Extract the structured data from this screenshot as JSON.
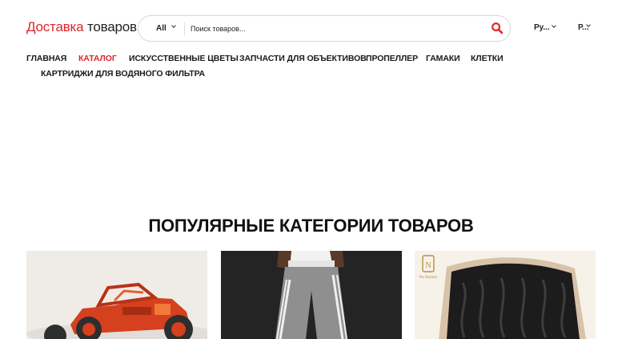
{
  "header": {
    "logo_accent": "Доставка",
    "logo_rest": "товаров",
    "search": {
      "category": "All",
      "placeholder": "Поиск товаров..."
    },
    "language": "Ру...",
    "currency": "Р..."
  },
  "nav": [
    {
      "label": "Главная"
    },
    {
      "label": "Каталог"
    },
    {
      "label": "Искусственные цветы"
    },
    {
      "label": "Запчасти для объективов"
    },
    {
      "label": "Пропеллер"
    },
    {
      "label": "Гамаки"
    },
    {
      "label": "Клетки"
    },
    {
      "label": "Картриджи для водяного фильтра"
    }
  ],
  "active_nav": "Каталог",
  "popular": {
    "title": "Популярные категории товаров",
    "cards": [
      {
        "image": "rc-buggy-photo",
        "brand_mark": ""
      },
      {
        "image": "sweatpants-photo",
        "brand_mark": ""
      },
      {
        "image": "hair-lace-frontal-photo",
        "brand_mark": "Na Beauty"
      }
    ]
  },
  "colors": {
    "accent": "#e0262a",
    "text": "#1a1a1a",
    "border": "#d6d6d6"
  },
  "icons": {
    "search": "search-icon",
    "dropdown": "chevron-down-icon"
  }
}
